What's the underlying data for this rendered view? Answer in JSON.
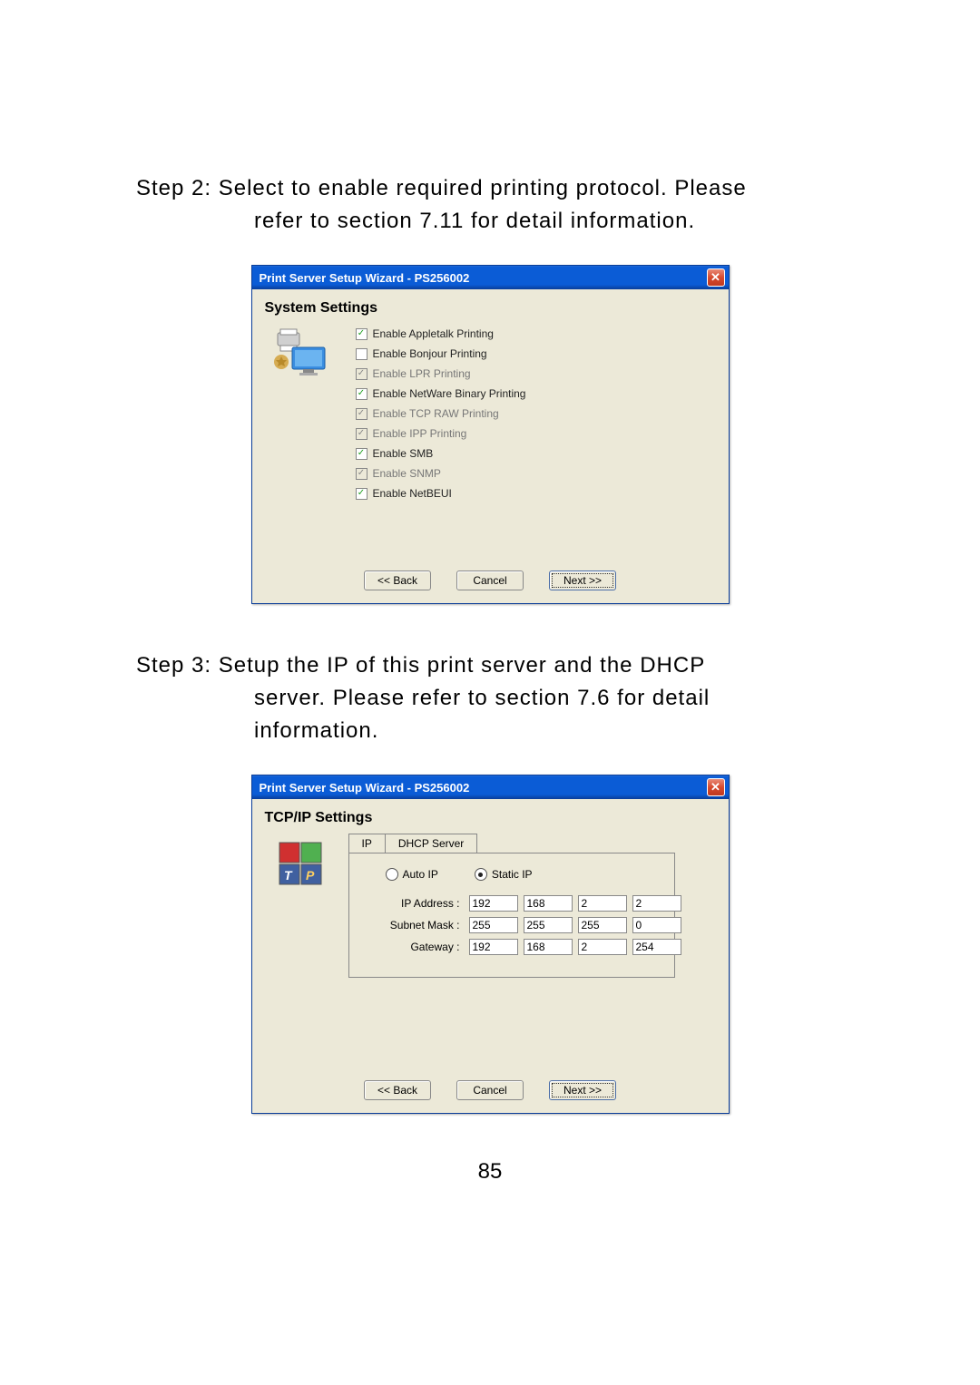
{
  "step2": {
    "line1": "Step 2: Select to enable required printing protocol. Please",
    "line2": "refer to section 7.11 for detail information."
  },
  "step3": {
    "line1": "Step 3: Setup the IP of this print server and the DHCP",
    "line2": "server. Please refer to section 7.6 for detail",
    "line3": "information."
  },
  "dialog1": {
    "title": "Print Server Setup Wizard - PS256002",
    "heading": "System Settings",
    "checkboxes": [
      {
        "label": "Enable Appletalk Printing",
        "checked": true,
        "disabled": false
      },
      {
        "label": "Enable Bonjour Printing",
        "checked": false,
        "disabled": false
      },
      {
        "label": "Enable LPR Printing",
        "checked": true,
        "disabled": true
      },
      {
        "label": "Enable NetWare Binary Printing",
        "checked": true,
        "disabled": false
      },
      {
        "label": "Enable TCP RAW Printing",
        "checked": true,
        "disabled": true
      },
      {
        "label": "Enable IPP Printing",
        "checked": true,
        "disabled": true
      },
      {
        "label": "Enable SMB",
        "checked": true,
        "disabled": false
      },
      {
        "label": "Enable SNMP",
        "checked": true,
        "disabled": true
      },
      {
        "label": "Enable NetBEUI",
        "checked": true,
        "disabled": false
      }
    ],
    "buttons": {
      "back": "<< Back",
      "cancel": "Cancel",
      "next": "Next >>"
    }
  },
  "dialog2": {
    "title": "Print Server Setup Wizard - PS256002",
    "heading": "TCP/IP Settings",
    "tabs": {
      "ip": "IP",
      "dhcp": "DHCP Server"
    },
    "radios": {
      "auto": "Auto IP",
      "static": "Static IP"
    },
    "rows": {
      "ip_label": "IP Address :",
      "subnet_label": "Subnet Mask :",
      "gateway_label": "Gateway :",
      "ip": [
        "192",
        "168",
        "2",
        "2"
      ],
      "subnet": [
        "255",
        "255",
        "255",
        "0"
      ],
      "gateway": [
        "192",
        "168",
        "2",
        "254"
      ]
    },
    "buttons": {
      "back": "<< Back",
      "cancel": "Cancel",
      "next": "Next >>"
    }
  },
  "page_number": "85"
}
